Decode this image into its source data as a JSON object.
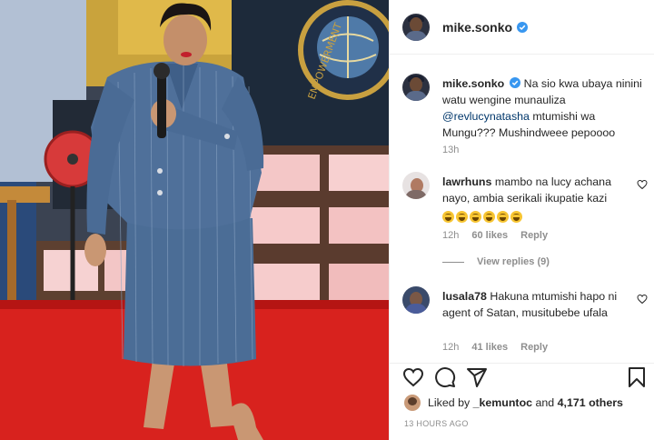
{
  "post": {
    "username": "mike.sonko",
    "verified": true,
    "caption": {
      "username": "mike.sonko",
      "text_before": "Na sio kwa ubaya ninini watu wengine munauliza ",
      "mention": "@revlucynatasha",
      "text_after": " mtumishi wa Mungu??? Mushindweee pepoooo",
      "age": "13h"
    }
  },
  "comments": [
    {
      "username": "lawrhuns",
      "text": "mambo na lucy achana nayo, ambia serikali ikupatie kazi",
      "emoji_count": 6,
      "emoji_icon": "rolling-laughing-emoji",
      "age": "12h",
      "likes": "60 likes",
      "reply": "Reply"
    },
    {
      "username": "lusala78",
      "text": "Hakuna mtumishi hapo ni agent of Satan, musitubebe ufala",
      "age": "12h",
      "likes": "41 likes",
      "reply": "Reply"
    }
  ],
  "view_replies": "View replies (9)",
  "actions": {
    "icons": [
      "heart-icon",
      "comment-icon",
      "share-icon",
      "bookmark-icon"
    ]
  },
  "likes": {
    "prefix": "Liked by ",
    "user": "_kemuntoc",
    "middle": " and ",
    "count": "4,171 others"
  },
  "timestamp": "13 HOURS AGO",
  "colors": {
    "verified": "#3897f0",
    "mention": "#00376b",
    "muted": "#8e8e8e",
    "text": "#262626"
  }
}
